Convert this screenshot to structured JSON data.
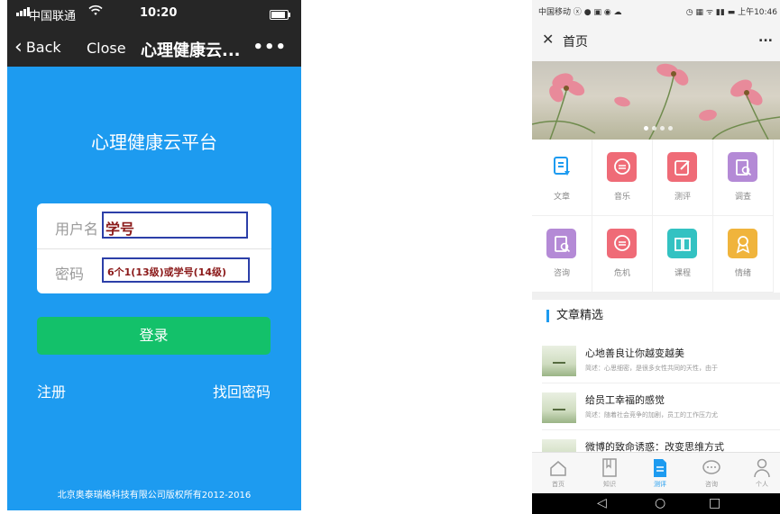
{
  "left_phone": {
    "status": {
      "carrier": "中国联通",
      "time": "10:20"
    },
    "nav": {
      "back": "Back",
      "close": "Close",
      "title": "心理健康云...",
      "more": "•••"
    },
    "app_title": "心理健康云平台",
    "form": {
      "username_label": "用户名",
      "username_value": "学号",
      "password_label": "密码",
      "password_value": "6个1(13级)或学号(14级)"
    },
    "login_button": "登录",
    "register_link": "注册",
    "forgot_link": "找回密码",
    "footer": "北京奥泰瑞格科技有限公司版权所有2012-2016",
    "colors": {
      "background": "#1d9bf0",
      "login": "#13c16a",
      "bar": "#262626"
    }
  },
  "right_phone": {
    "status": {
      "carrier": "中国移动",
      "right": "上午10:46"
    },
    "nav": {
      "close_icon": "close-icon",
      "title": "首页",
      "more": "..."
    },
    "banner": {
      "dots": 4,
      "active_dot": 0
    },
    "grid": [
      {
        "label": "文章",
        "icon": "document-icon",
        "color": "#ffffff"
      },
      {
        "label": "音乐",
        "icon": "chat-icon",
        "color": "#ef6b77"
      },
      {
        "label": "测评",
        "icon": "edit-icon",
        "color": "#ef6b77"
      },
      {
        "label": "调查",
        "icon": "survey-icon",
        "color": "#b48ad6"
      },
      {
        "label": "咨询",
        "icon": "survey-icon",
        "color": "#b48ad6"
      },
      {
        "label": "危机",
        "icon": "chat-icon",
        "color": "#ef6b77"
      },
      {
        "label": "课程",
        "icon": "book-icon",
        "color": "#33c2c2"
      },
      {
        "label": "情绪",
        "icon": "ribbon-icon",
        "color": "#f0b43c"
      }
    ],
    "section_title": "文章精选",
    "articles": [
      {
        "title": "心地善良让你越变越美",
        "desc": "简述：心思细密，是很多女性共同的天性，由于"
      },
      {
        "title": "给员工幸福的感觉",
        "desc": "简述：随着社会竞争的加剧，员工的工作压力尤"
      },
      {
        "title": "微博的致命诱惑：改变思维方式",
        "desc": ""
      }
    ],
    "tabs": [
      {
        "label": "首页",
        "icon": "home-icon"
      },
      {
        "label": "知识",
        "icon": "bookmark-icon"
      },
      {
        "label": "测评",
        "icon": "doc-icon",
        "active": true
      },
      {
        "label": "咨询",
        "icon": "bubble-icon"
      },
      {
        "label": "个人",
        "icon": "person-icon"
      }
    ],
    "sysnav": {
      "back": "◁",
      "home": "○",
      "recent": "□"
    }
  }
}
